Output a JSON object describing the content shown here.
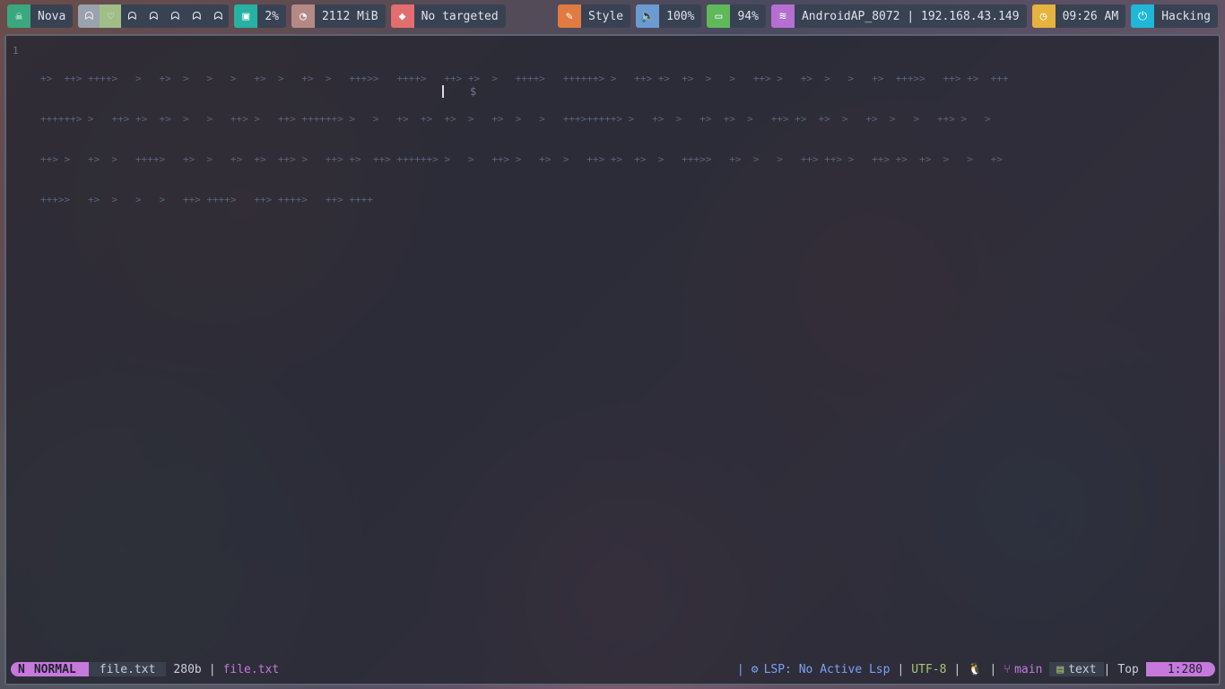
{
  "topbar": {
    "user": {
      "icon": "skull-icon",
      "label": "Nova",
      "color": "#3aa77f"
    },
    "workspaces": [
      {
        "icon": "ghost-icon",
        "glyph": "👻",
        "active": true
      },
      {
        "icon": "heart-icon",
        "glyph": "♡",
        "active": true
      },
      {
        "icon": "ghost-icon",
        "glyph": "👻"
      },
      {
        "icon": "ghost-icon",
        "glyph": "👻"
      },
      {
        "icon": "ghost-icon",
        "glyph": "👻"
      },
      {
        "icon": "ghost-icon",
        "glyph": "👻"
      },
      {
        "icon": "ghost-icon",
        "glyph": "👻"
      }
    ],
    "cpu": {
      "icon": "cpu-icon",
      "label": "2%",
      "color": "#27b1a5"
    },
    "memory": {
      "icon": "pie-icon",
      "label": "2112 MiB",
      "color": "#b58a85"
    },
    "window": {
      "icon": "tag-icon",
      "label": "No targeted",
      "color": "#e36d6f"
    },
    "style": {
      "icon": "brush-icon",
      "label": "Style",
      "color": "#e17b42"
    },
    "volume": {
      "icon": "speaker-icon",
      "label": "100%",
      "color": "#6c9bd2"
    },
    "battery": {
      "icon": "battery-icon",
      "label": "94%",
      "color": "#5fb95b"
    },
    "network": {
      "icon": "wifi-icon",
      "label": "AndroidAP_8072 | 192.168.43.149",
      "color": "#b56fd0"
    },
    "clock": {
      "icon": "clock-icon",
      "label": "09:26 AM",
      "color": "#e6b33f"
    },
    "power": {
      "icon": "power-icon",
      "label": "Hacking",
      "color": "#1fb8d8"
    }
  },
  "editor": {
    "line_number": "1",
    "content": [
      "+>  ++> ++++>   >   +>  >   >   >   +>  >   +>  >   +++>>   ++++>   ++> +>  >   ++++>   ++++++> >   ++> +>  +>  >   >   ++> >   +>  >   >   +>  +++>>   ++> +>  +++",
      "++++++> >   ++> +>  +>  >   >   ++> >   ++> ++++++> >   >   +>  +>  +>  >   +>  >   >   +++>+++++> >   +>  >   +>  +>  >   ++> +>  +>  >   +>  >   >   ++> >   >",
      "++> >   +>  >   ++++>   +>  >   +>  +>  ++> >   ++> +>  ++> ++++++> >   >   ++> >   +>  >   ++> +>  +>  >   +++>>   +>  >   >   ++> ++> >   ++> +>  +>  >   >   +>",
      "+++>>   +>  >   >   >   ++> ++++>   ++> ++++>   ++> ++++"
    ],
    "prompt": "$"
  },
  "statusline": {
    "mode_icon": "N",
    "mode": "NORMAL",
    "file": "file.txt",
    "size": "280b",
    "sep": "|",
    "file_path": "file.txt",
    "lsp": "LSP: No Active Lsp",
    "encoding": "UTF-8",
    "os_icon": "penguin-icon",
    "branch": "main",
    "filetype": "text",
    "scroll": "Top",
    "position": "1:280"
  }
}
